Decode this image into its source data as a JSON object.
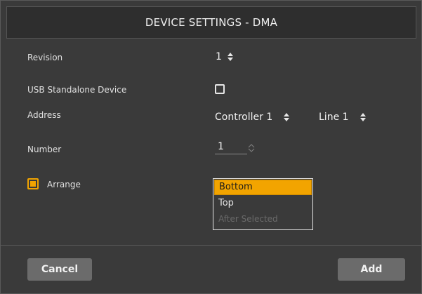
{
  "dialog": {
    "title": "DEVICE SETTINGS - DMA"
  },
  "fields": {
    "revision": {
      "label": "Revision",
      "value": "1"
    },
    "usb_standalone": {
      "label": "USB Standalone Device",
      "checked": false
    },
    "address": {
      "label": "Address",
      "controller": "Controller 1",
      "line": "Line 1"
    },
    "number": {
      "label": "Number",
      "value": "1"
    },
    "arrange": {
      "label": "Arrange",
      "checked": true,
      "options": [
        {
          "label": "Bottom",
          "selected": true,
          "enabled": true
        },
        {
          "label": "Top",
          "selected": false,
          "enabled": true
        },
        {
          "label": "After Selected",
          "selected": false,
          "enabled": false
        }
      ]
    }
  },
  "footer": {
    "cancel_label": "Cancel",
    "add_label": "Add"
  },
  "colors": {
    "accent": "#f2a400",
    "background": "#3a3a3a",
    "button": "#6b6b6b"
  }
}
